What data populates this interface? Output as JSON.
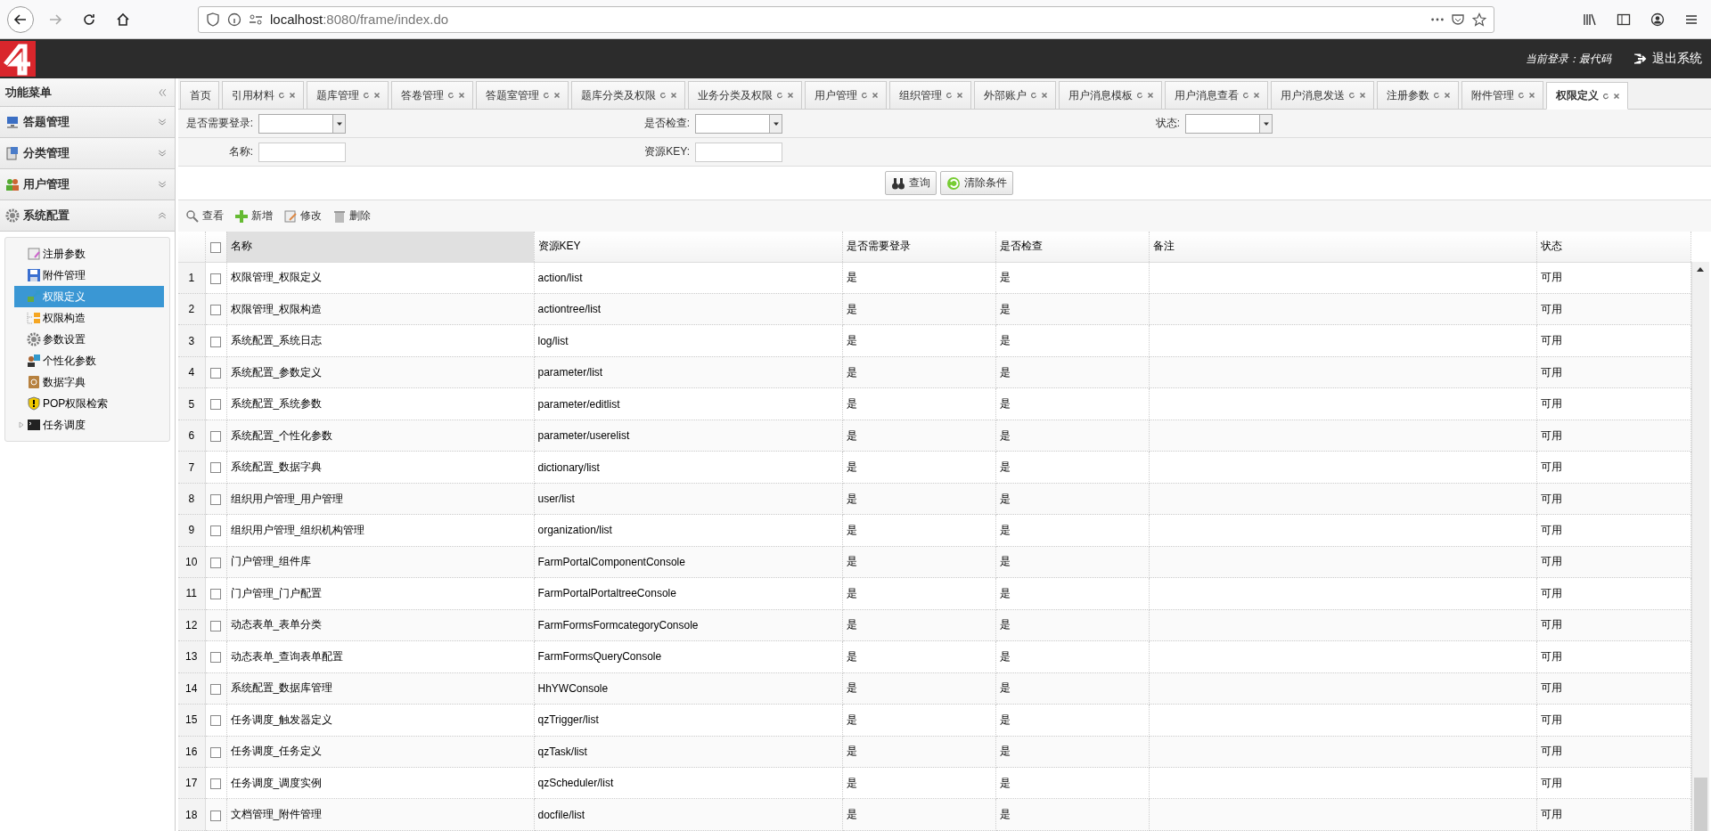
{
  "browser": {
    "url_host": "localhost",
    "url_rest": ":8080/frame/index.do"
  },
  "header": {
    "login_label": "当前登录：最代码",
    "logout": "退出系统"
  },
  "sidebar": {
    "title": "功能菜单",
    "sections": [
      {
        "label": "答题管理",
        "expanded": false
      },
      {
        "label": "分类管理",
        "expanded": false
      },
      {
        "label": "用户管理",
        "expanded": false
      },
      {
        "label": "系统配置",
        "expanded": true,
        "items": [
          {
            "label": "注册参数",
            "selected": false
          },
          {
            "label": "附件管理",
            "selected": false
          },
          {
            "label": "权限定义",
            "selected": true
          },
          {
            "label": "权限构造",
            "selected": false
          },
          {
            "label": "参数设置",
            "selected": false
          },
          {
            "label": "个性化参数",
            "selected": false
          },
          {
            "label": "数据字典",
            "selected": false
          },
          {
            "label": "POP权限检索",
            "selected": false
          },
          {
            "label": "任务调度",
            "selected": false,
            "expanded": false
          }
        ]
      }
    ]
  },
  "tabs": [
    {
      "label": "首页",
      "selected": false,
      "closable": false
    },
    {
      "label": "引用材料",
      "selected": false,
      "closable": true
    },
    {
      "label": "题库管理",
      "selected": false,
      "closable": true
    },
    {
      "label": "答卷管理",
      "selected": false,
      "closable": true
    },
    {
      "label": "答题室管理",
      "selected": false,
      "closable": true
    },
    {
      "label": "题库分类及权限",
      "selected": false,
      "closable": true
    },
    {
      "label": "业务分类及权限",
      "selected": false,
      "closable": true
    },
    {
      "label": "用户管理",
      "selected": false,
      "closable": true
    },
    {
      "label": "组织管理",
      "selected": false,
      "closable": true
    },
    {
      "label": "外部账户",
      "selected": false,
      "closable": true
    },
    {
      "label": "用户消息模板",
      "selected": false,
      "closable": true
    },
    {
      "label": "用户消息查看",
      "selected": false,
      "closable": true
    },
    {
      "label": "用户消息发送",
      "selected": false,
      "closable": true
    },
    {
      "label": "注册参数",
      "selected": false,
      "closable": true
    },
    {
      "label": "附件管理",
      "selected": false,
      "closable": true
    },
    {
      "label": "权限定义",
      "selected": true,
      "closable": true
    }
  ],
  "filters": [
    {
      "label": "是否需要登录:",
      "kind": "select"
    },
    {
      "label": "是否检查:",
      "kind": "select"
    },
    {
      "label": "状态:",
      "kind": "select"
    },
    {
      "label": "名称:",
      "kind": "input"
    },
    {
      "label": "资源KEY:",
      "kind": "input"
    }
  ],
  "search_buttons": [
    "查询",
    "清除条件"
  ],
  "toolbar": [
    "查看",
    "新增",
    "修改",
    "删除"
  ],
  "table": {
    "all_checked": false,
    "columns": [
      {
        "label": "名称",
        "highlighted": true
      },
      {
        "label": "资源KEY",
        "highlighted": false
      },
      {
        "label": "是否需要登录",
        "highlighted": false
      },
      {
        "label": "是否检查",
        "highlighted": false
      },
      {
        "label": "备注",
        "highlighted": false
      },
      {
        "label": "状态",
        "highlighted": false
      }
    ],
    "rows": [
      {
        "num": "1",
        "checked": false,
        "name": "权限管理_权限定义",
        "key": "action/list",
        "login": "是",
        "check": "是",
        "status": "可用"
      },
      {
        "num": "2",
        "checked": false,
        "name": "权限管理_权限构造",
        "key": "actiontree/list",
        "login": "是",
        "check": "是",
        "status": "可用"
      },
      {
        "num": "3",
        "checked": false,
        "name": "系统配置_系统日志",
        "key": "log/list",
        "login": "是",
        "check": "是",
        "status": "可用"
      },
      {
        "num": "4",
        "checked": false,
        "name": "系统配置_参数定义",
        "key": "parameter/list",
        "login": "是",
        "check": "是",
        "status": "可用"
      },
      {
        "num": "5",
        "checked": false,
        "name": "系统配置_系统参数",
        "key": "parameter/editlist",
        "login": "是",
        "check": "是",
        "status": "可用"
      },
      {
        "num": "6",
        "checked": false,
        "name": "系统配置_个性化参数",
        "key": "parameter/userelist",
        "login": "是",
        "check": "是",
        "status": "可用"
      },
      {
        "num": "7",
        "checked": false,
        "name": "系统配置_数据字典",
        "key": "dictionary/list",
        "login": "是",
        "check": "是",
        "status": "可用"
      },
      {
        "num": "8",
        "checked": false,
        "name": "组织用户管理_用户管理",
        "key": "user/list",
        "login": "是",
        "check": "是",
        "status": "可用"
      },
      {
        "num": "9",
        "checked": false,
        "name": "组织用户管理_组织机构管理",
        "key": "organization/list",
        "login": "是",
        "check": "是",
        "status": "可用"
      },
      {
        "num": "10",
        "checked": false,
        "name": "门户管理_组件库",
        "key": "FarmPortalComponentConsole",
        "login": "是",
        "check": "是",
        "status": "可用"
      },
      {
        "num": "11",
        "checked": false,
        "name": "门户管理_门户配置",
        "key": "FarmPortalPortaltreeConsole",
        "login": "是",
        "check": "是",
        "status": "可用"
      },
      {
        "num": "12",
        "checked": false,
        "name": "动态表单_表单分类",
        "key": "FarmFormsFormcategoryConsole",
        "login": "是",
        "check": "是",
        "status": "可用"
      },
      {
        "num": "13",
        "checked": false,
        "name": "动态表单_查询表单配置",
        "key": "FarmFormsQueryConsole",
        "login": "是",
        "check": "是",
        "status": "可用"
      },
      {
        "num": "14",
        "checked": false,
        "name": "系统配置_数据库管理",
        "key": "HhYWConsole",
        "login": "是",
        "check": "是",
        "status": "可用"
      },
      {
        "num": "15",
        "checked": false,
        "name": "任务调度_触发器定义",
        "key": "qzTrigger/list",
        "login": "是",
        "check": "是",
        "status": "可用"
      },
      {
        "num": "16",
        "checked": false,
        "name": "任务调度_任务定义",
        "key": "qzTask/list",
        "login": "是",
        "check": "是",
        "status": "可用"
      },
      {
        "num": "17",
        "checked": false,
        "name": "任务调度_调度实例",
        "key": "qzScheduler/list",
        "login": "是",
        "check": "是",
        "status": "可用"
      },
      {
        "num": "18",
        "checked": false,
        "name": "文档管理_附件管理",
        "key": "docfile/list",
        "login": "是",
        "check": "是",
        "status": "可用"
      }
    ]
  }
}
